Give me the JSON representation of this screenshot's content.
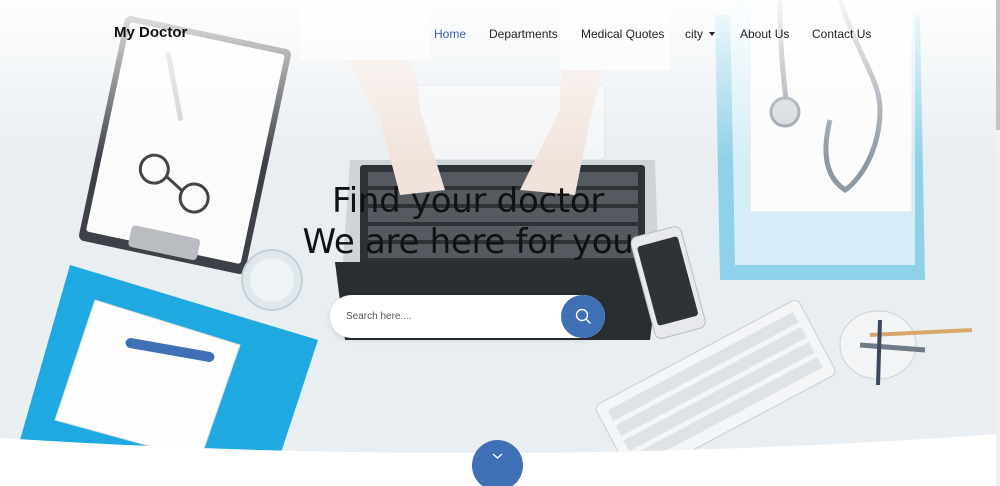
{
  "brand": "My Doctor",
  "nav": {
    "items": [
      "Home",
      "Departments",
      "Medical Quotes",
      "city",
      "About Us",
      "Contact Us"
    ],
    "active": "Home"
  },
  "hero": {
    "title_line1": "Find your doctor",
    "title_line2": "We are here for you"
  },
  "search": {
    "placeholder": "Search here....",
    "value": "",
    "button_icon": "search-icon"
  },
  "scroll_button_icon": "chevron-down-icon",
  "colors": {
    "accent": "#3f6fb4",
    "active_link": "#3a62b0",
    "folder_blue": "#1fa9e0"
  }
}
